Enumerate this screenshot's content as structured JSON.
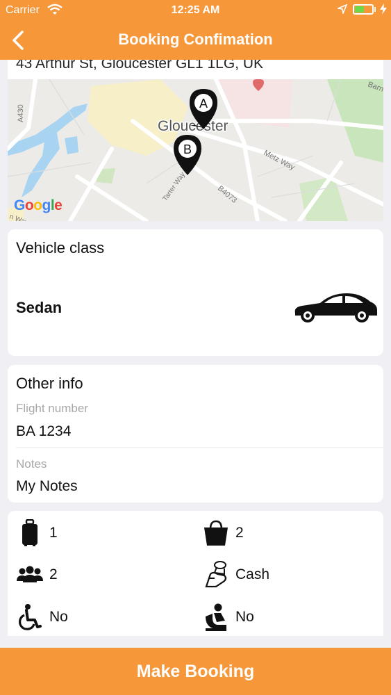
{
  "status_bar": {
    "carrier": "Carrier",
    "time": "12:25 AM",
    "battery_level": 0.55
  },
  "nav": {
    "title": "Booking Confimation"
  },
  "address": {
    "text": "43 Arthur St, Gloucester GL1 1LG, UK"
  },
  "map": {
    "city_label": "Gloucester",
    "road_labels": [
      "A430",
      "Metz Way",
      "Tarter Way",
      "B4073",
      "n Way",
      "Barn"
    ],
    "markers": [
      "A",
      "B"
    ],
    "google_logo": {
      "G1": "G",
      "o1": "o",
      "o2": "o",
      "g": "g",
      "l": "l",
      "e": "e"
    }
  },
  "vehicle": {
    "heading": "Vehicle class",
    "name": "Sedan"
  },
  "other_info": {
    "heading": "Other info",
    "flight_label": "Flight number",
    "flight_value": "BA 1234",
    "notes_label": "Notes",
    "notes_value": "My Notes"
  },
  "extras": {
    "luggage": "1",
    "bags": "2",
    "passengers": "2",
    "payment": "Cash",
    "wheelchair": "No",
    "child_seat": "No"
  },
  "actions": {
    "make_booking": "Make Booking"
  },
  "colors": {
    "brand": "#f6973a",
    "background": "#efeff4"
  }
}
